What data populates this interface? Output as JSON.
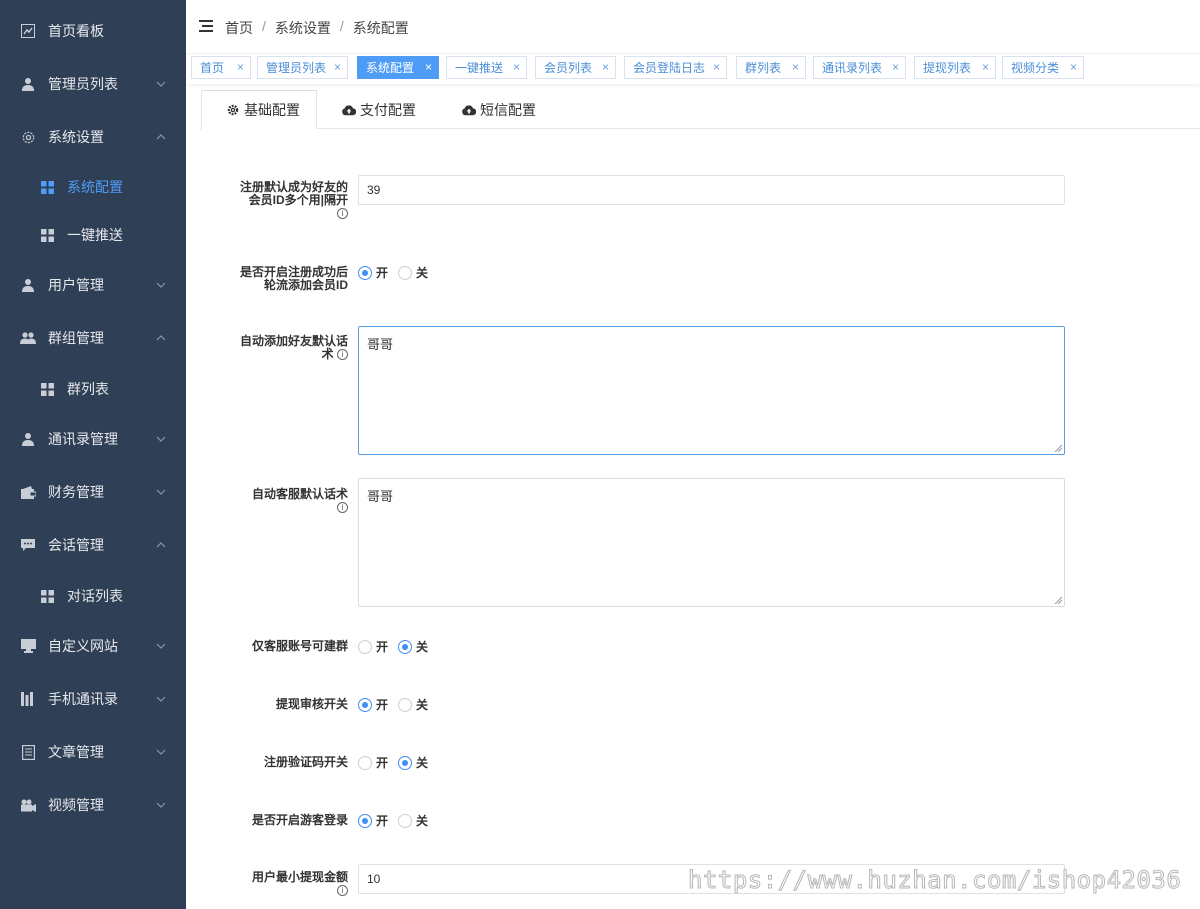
{
  "sidebar": {
    "items": [
      {
        "label": "首页看板",
        "icon": "dashboard-icon"
      },
      {
        "label": "管理员列表",
        "icon": "user-icon"
      },
      {
        "label": "系统设置",
        "icon": "gear-icon"
      },
      {
        "label": "系统配置",
        "icon": "grid-icon"
      },
      {
        "label": "一键推送",
        "icon": "grid-icon"
      },
      {
        "label": "用户管理",
        "icon": "user-icon"
      },
      {
        "label": "群组管理",
        "icon": "group-icon"
      },
      {
        "label": "群列表",
        "icon": "grid-icon"
      },
      {
        "label": "通讯录管理",
        "icon": "user-icon"
      },
      {
        "label": "财务管理",
        "icon": "wallet-icon"
      },
      {
        "label": "会话管理",
        "icon": "chat-icon"
      },
      {
        "label": "对话列表",
        "icon": "grid-icon"
      },
      {
        "label": "自定义网站",
        "icon": "monitor-icon"
      },
      {
        "label": "手机通讯录",
        "icon": "bars-icon"
      },
      {
        "label": "文章管理",
        "icon": "document-icon"
      },
      {
        "label": "视频管理",
        "icon": "camera-icon"
      }
    ]
  },
  "breadcrumb": [
    "首页",
    "系统设置",
    "系统配置"
  ],
  "tabs": [
    {
      "label": "首页"
    },
    {
      "label": "管理员列表"
    },
    {
      "label": "系统配置"
    },
    {
      "label": "一键推送"
    },
    {
      "label": "会员列表"
    },
    {
      "label": "会员登陆日志"
    },
    {
      "label": "群列表"
    },
    {
      "label": "通讯录列表"
    },
    {
      "label": "提现列表"
    },
    {
      "label": "视频分类"
    }
  ],
  "tab_close": "×",
  "config_tabs": [
    {
      "label": "基础配置"
    },
    {
      "label": "支付配置"
    },
    {
      "label": "短信配置"
    }
  ],
  "form": {
    "default_friend": {
      "label_line1": "注册默认成为好友的",
      "label_line2": "会员ID多个用|隔开",
      "value": "39"
    },
    "auto_add": {
      "label_line1": "是否开启注册成功后",
      "label_line2": "轮流添加会员ID",
      "on": "开",
      "off": "关",
      "selected": "on"
    },
    "auto_friend_script": {
      "label_line1": "自动添加好友默认话",
      "label_line2": "术",
      "value": "哥哥"
    },
    "auto_cs_script": {
      "label_line1": "自动客服默认话术",
      "value": "哥哥"
    },
    "cs_only_group": {
      "label": "仅客服账号可建群",
      "on": "开",
      "off": "关",
      "selected": "off"
    },
    "withdraw_review": {
      "label": "提现审核开关",
      "on": "开",
      "off": "关",
      "selected": "on"
    },
    "register_captcha": {
      "label": "注册验证码开关",
      "on": "开",
      "off": "关",
      "selected": "off"
    },
    "guest_login": {
      "label": "是否开启游客登录",
      "on": "开",
      "off": "关",
      "selected": "on"
    },
    "min_withdraw": {
      "label": "用户最小提现金额",
      "value": "10"
    }
  },
  "info_glyph": "i",
  "watermark": "https://www.huzhan.com/ishop42036",
  "colors": {
    "sidebar_bg": "#2f4056",
    "accent": "#4f9cf7",
    "radio_on": "#3e8ef7"
  }
}
